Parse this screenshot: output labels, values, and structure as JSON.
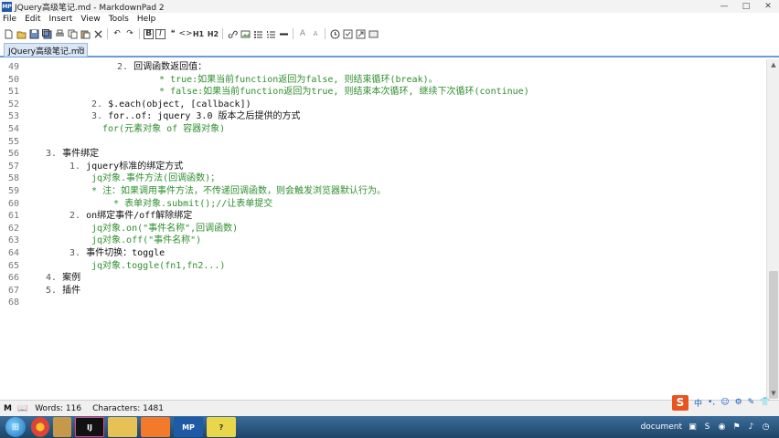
{
  "window": {
    "title": "JQuery高级笔记.md - MarkdownPad 2",
    "app_icon_label": "MP",
    "minimize": "—",
    "maximize": "□",
    "close": "✕"
  },
  "menu": [
    "File",
    "Edit",
    "Insert",
    "View",
    "Tools",
    "Help"
  ],
  "toolbar": {
    "icons": [
      "new-file-icon",
      "open-folder-icon",
      "save-icon",
      "save-all-icon",
      "print-icon",
      "copy-icon",
      "paste-icon",
      "cut-icon",
      "undo-icon",
      "redo-icon",
      "bold-icon",
      "italic-icon",
      "quote-icon",
      "code-icon",
      "h1-icon",
      "h2-icon",
      "link-icon",
      "image-icon",
      "bullet-list-icon",
      "numbered-list-icon",
      "horizontal-rule-icon",
      "font-up-icon",
      "font-down-icon",
      "timestamp-icon",
      "preview-icon",
      "export-icon",
      "fullscreen-icon"
    ],
    "h1": "H1",
    "h2": "H2",
    "font_up": "A",
    "font_down": "A"
  },
  "tab": {
    "label": "JQuery高级笔记.md",
    "close": "✕"
  },
  "editor": {
    "line_numbers": [
      "49",
      "50",
      "51",
      "52",
      "53",
      "54",
      "55",
      "56",
      "57",
      "58",
      "59",
      "60",
      "61",
      "62",
      "63",
      "64",
      "65",
      "66",
      "67",
      "68"
    ],
    "lines": [
      {
        "n": "49",
        "indent": 100,
        "list": "2.",
        "text": "回调函数返回值：",
        "cls": ""
      },
      {
        "n": "50",
        "indent": 146,
        "list": "*",
        "text": "true:如果当前function返回为false, 则结束循环(break)。",
        "cls": "green"
      },
      {
        "n": "51",
        "indent": 146,
        "list": "*",
        "text": "false:如果当前function返回为true, 则结束本次循环, 继续下次循环(continue)",
        "cls": "green"
      },
      {
        "n": "52",
        "indent": 72,
        "list": "2.",
        "text": "$.each(object, [callback])",
        "cls": ""
      },
      {
        "n": "53",
        "indent": 72,
        "list": "3.",
        "text": "for..of: jquery 3.0 版本之后提供的方式",
        "cls": ""
      },
      {
        "n": "54",
        "indent": 84,
        "list": "",
        "text": "for(元素对象 of 容器对象)",
        "cls": "green"
      },
      {
        "n": "55",
        "indent": 0,
        "list": "",
        "text": "",
        "cls": ""
      },
      {
        "n": "56",
        "indent": 22,
        "list": "3.",
        "text": "事件绑定",
        "cls": ""
      },
      {
        "n": "57",
        "indent": 48,
        "list": "1.",
        "text": "jquery标准的绑定方式",
        "cls": ""
      },
      {
        "n": "58",
        "indent": 72,
        "list": "",
        "text": "jq对象.事件方法(回调函数)；",
        "cls": "green"
      },
      {
        "n": "59",
        "indent": 72,
        "list": "*",
        "text": "注：如果调用事件方法，不传递回调函数，则会触发浏览器默认行为。",
        "cls": "green"
      },
      {
        "n": "60",
        "indent": 96,
        "list": "*",
        "text": "表单对象.submit();//让表单提交",
        "cls": "green"
      },
      {
        "n": "61",
        "indent": 48,
        "list": "2.",
        "text": "on绑定事件/off解除绑定",
        "cls": ""
      },
      {
        "n": "62",
        "indent": 72,
        "list": "",
        "text": "jq对象.on(\"事件名称\",回调函数)",
        "cls": "green"
      },
      {
        "n": "63",
        "indent": 72,
        "list": "",
        "text": "jq对象.off(\"事件名称\")",
        "cls": "green"
      },
      {
        "n": "64",
        "indent": 48,
        "list": "3.",
        "text": "事件切换：toggle",
        "cls": ""
      },
      {
        "n": "65",
        "indent": 72,
        "list": "",
        "text": "jq对象.toggle(fn1,fn2...)",
        "cls": "green"
      },
      {
        "n": "66",
        "indent": 22,
        "list": "4.",
        "text": "案例",
        "cls": ""
      },
      {
        "n": "67",
        "indent": 22,
        "list": "5.",
        "text": "插件",
        "cls": ""
      },
      {
        "n": "68",
        "indent": 0,
        "list": "",
        "text": "",
        "cls": ""
      }
    ]
  },
  "status": {
    "words": "Words: 116",
    "characters": "Characters: 1481"
  },
  "ime": {
    "logo": "S",
    "lang": "中"
  },
  "taskbar": {
    "tray_text": "document"
  }
}
